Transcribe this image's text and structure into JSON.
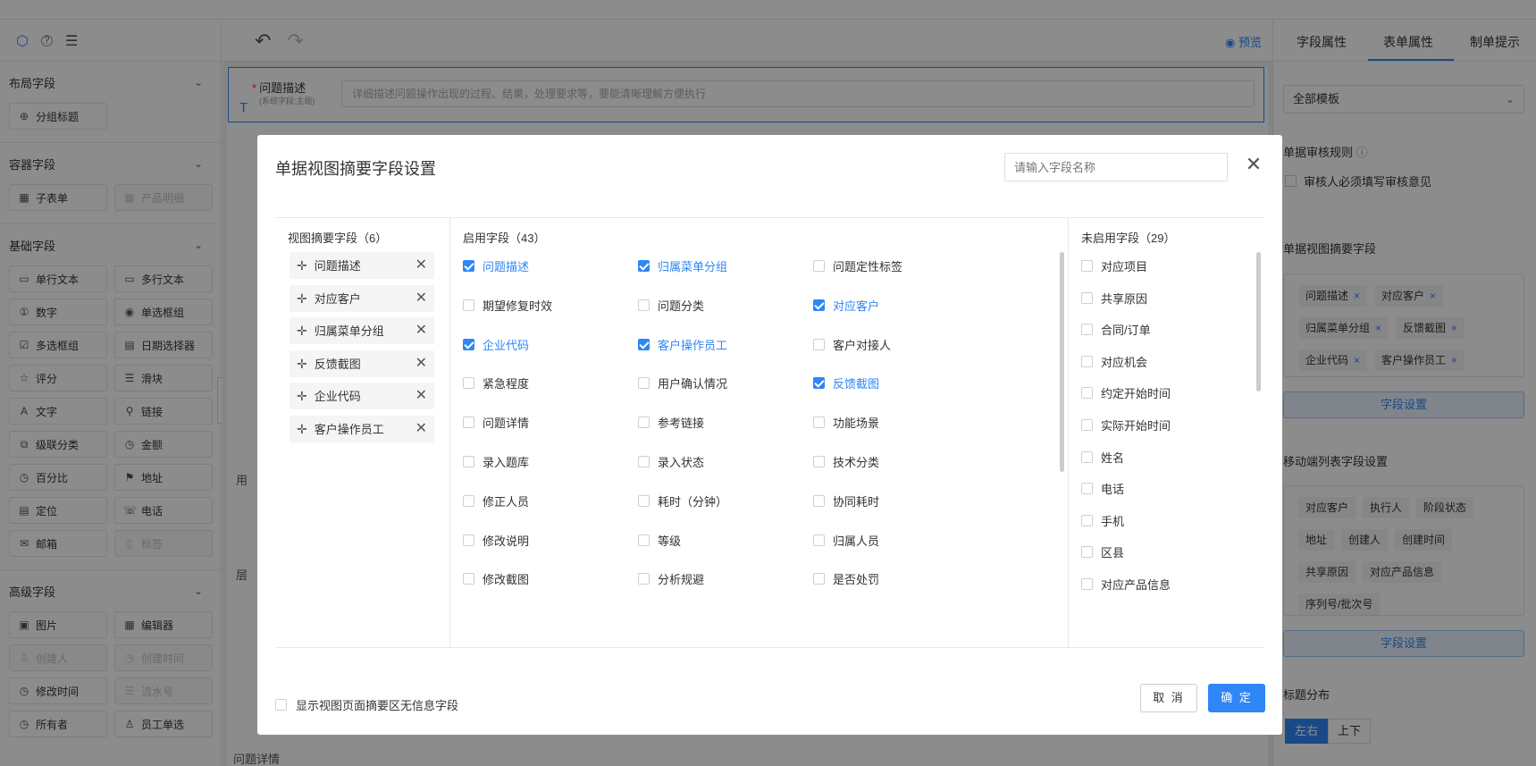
{
  "left": {
    "tabs": [
      "⬡",
      "?",
      "≣"
    ],
    "sections": [
      {
        "title": "布局字段",
        "items": [
          {
            "label": "分组标题",
            "icon": "group-icon",
            "disabled": false
          }
        ]
      },
      {
        "title": "容器字段",
        "items": [
          {
            "label": "子表单",
            "icon": "table-icon",
            "disabled": false
          },
          {
            "label": "产品明细",
            "icon": "table-icon",
            "disabled": true
          }
        ]
      },
      {
        "title": "基础字段",
        "items": [
          {
            "label": "单行文本",
            "icon": "input-icon",
            "disabled": false
          },
          {
            "label": "多行文本",
            "icon": "textarea-icon",
            "disabled": false
          },
          {
            "label": "数字",
            "icon": "number-icon",
            "disabled": false
          },
          {
            "label": "单选框组",
            "icon": "radio-icon",
            "disabled": false
          },
          {
            "label": "多选框组",
            "icon": "checkbox-icon",
            "disabled": false
          },
          {
            "label": "日期选择器",
            "icon": "calendar-icon",
            "disabled": false
          },
          {
            "label": "评分",
            "icon": "star-icon",
            "disabled": false
          },
          {
            "label": "滑块",
            "icon": "slider-icon",
            "disabled": false
          },
          {
            "label": "文字",
            "icon": "text-icon",
            "disabled": false
          },
          {
            "label": "链接",
            "icon": "link-icon",
            "disabled": false
          },
          {
            "label": "级联分类",
            "icon": "cascade-icon",
            "disabled": false
          },
          {
            "label": "金额",
            "icon": "money-icon",
            "disabled": false
          },
          {
            "label": "百分比",
            "icon": "percent-icon",
            "disabled": false
          },
          {
            "label": "地址",
            "icon": "pin-icon",
            "disabled": false
          },
          {
            "label": "定位",
            "icon": "doc-icon",
            "disabled": false
          },
          {
            "label": "电话",
            "icon": "phone-icon",
            "disabled": false
          },
          {
            "label": "邮箱",
            "icon": "mail-icon",
            "disabled": false
          },
          {
            "label": "标签",
            "icon": "tag-icon",
            "disabled": true
          }
        ]
      },
      {
        "title": "高级字段",
        "items": [
          {
            "label": "图片",
            "icon": "image-icon",
            "disabled": false
          },
          {
            "label": "编辑器",
            "icon": "editor-icon",
            "disabled": false
          },
          {
            "label": "创建人",
            "icon": "user-icon",
            "disabled": true
          },
          {
            "label": "创建时间",
            "icon": "clock-icon",
            "disabled": true
          },
          {
            "label": "修改时间",
            "icon": "clock-icon",
            "disabled": false
          },
          {
            "label": "流水号",
            "icon": "list-icon",
            "disabled": true
          },
          {
            "label": "所有者",
            "icon": "clock-icon",
            "disabled": false
          },
          {
            "label": "员工单选",
            "icon": "user-icon",
            "disabled": false
          }
        ]
      }
    ]
  },
  "center": {
    "preview_label": "预览",
    "field_label": "问题描述",
    "field_sub": "(系统字段:主题)",
    "field_placeholder": "详细描述问题操作出现的过程、结果，处理要求等，要能清晰理解方便执行",
    "bg_labels": [
      "用",
      "层",
      "问题详情"
    ]
  },
  "right": {
    "tabs": [
      "字段属性",
      "表单属性",
      "制单提示"
    ],
    "active_tab": "表单属性",
    "template_select": "全部模板",
    "audit_rule_title": "单据审核规则",
    "audit_option": "审核人必须填写审核意见",
    "summary_title": "单据视图摘要字段",
    "summary_tags": [
      "问题描述",
      "对应客户",
      "归属菜单分组",
      "反馈截图",
      "企业代码",
      "客户操作员工"
    ],
    "field_settings_label": "字段设置",
    "mobile_title": "移动端列表字段设置",
    "mobile_tags": [
      "对应客户",
      "执行人",
      "阶段状态",
      "地址",
      "创建人",
      "创建时间",
      "共享原因",
      "对应产品信息",
      "序列号/批次号"
    ],
    "title_layout_title": "标题分布",
    "layout_options": [
      "左右",
      "上下"
    ],
    "layout_selected": "左右"
  },
  "modal": {
    "title": "单据视图摘要字段设置",
    "search_placeholder": "请输入字段名称",
    "summary_header": "视图摘要字段（6）",
    "summary_fields": [
      "问题描述",
      "对应客户",
      "归属菜单分组",
      "反馈截图",
      "企业代码",
      "客户操作员工"
    ],
    "enabled_header": "启用字段（43）",
    "enabled_fields": [
      {
        "label": "问题描述",
        "checked": true
      },
      {
        "label": "归属菜单分组",
        "checked": true
      },
      {
        "label": "问题定性标签",
        "checked": false
      },
      {
        "label": "期望修复时效",
        "checked": false
      },
      {
        "label": "问题分类",
        "checked": false
      },
      {
        "label": "对应客户",
        "checked": true
      },
      {
        "label": "企业代码",
        "checked": true
      },
      {
        "label": "客户操作员工",
        "checked": true
      },
      {
        "label": "客户对接人",
        "checked": false
      },
      {
        "label": "紧急程度",
        "checked": false
      },
      {
        "label": "用户确认情况",
        "checked": false
      },
      {
        "label": "反馈截图",
        "checked": true
      },
      {
        "label": "问题详情",
        "checked": false
      },
      {
        "label": "参考链接",
        "checked": false
      },
      {
        "label": "功能场景",
        "checked": false
      },
      {
        "label": "录入题库",
        "checked": false
      },
      {
        "label": "录入状态",
        "checked": false
      },
      {
        "label": "技术分类",
        "checked": false
      },
      {
        "label": "修正人员",
        "checked": false
      },
      {
        "label": "耗时（分钟）",
        "checked": false
      },
      {
        "label": "协同耗时",
        "checked": false
      },
      {
        "label": "修改说明",
        "checked": false
      },
      {
        "label": "等级",
        "checked": false
      },
      {
        "label": "归属人员",
        "checked": false
      },
      {
        "label": "修改截图",
        "checked": false
      },
      {
        "label": "分析规避",
        "checked": false
      },
      {
        "label": "是否处罚",
        "checked": false
      }
    ],
    "disabled_header": "未启用字段（29）",
    "disabled_fields": [
      "对应项目",
      "共享原因",
      "合同/订单",
      "对应机会",
      "约定开始时间",
      "实际开始时间",
      "姓名",
      "电话",
      "手机",
      "区县",
      "对应产品信息"
    ],
    "footer_checkbox": "显示视图页面摘要区无信息字段",
    "cancel_label": "取 消",
    "ok_label": "确 定"
  }
}
